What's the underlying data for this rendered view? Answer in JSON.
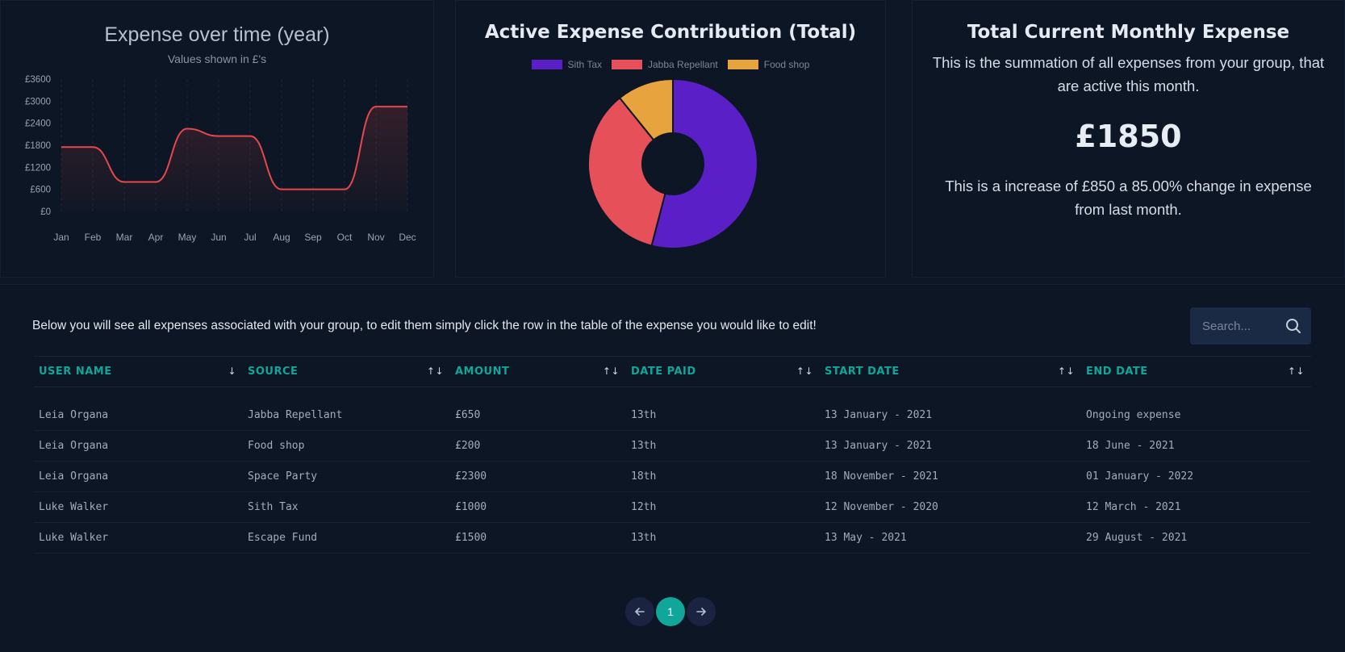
{
  "line_chart": {
    "title": "Expense over time (year)",
    "subtitle": "Values shown in £'s",
    "line_color": "#e5484d",
    "chart_data": {
      "type": "area",
      "categories": [
        "Jan",
        "Feb",
        "Mar",
        "Apr",
        "May",
        "Jun",
        "Jul",
        "Aug",
        "Sep",
        "Oct",
        "Nov",
        "Dec"
      ],
      "values": [
        1750,
        1750,
        800,
        800,
        2250,
        2050,
        2050,
        600,
        600,
        600,
        2850,
        2850
      ],
      "yticks": [
        "£0",
        "£600",
        "£1200",
        "£1800",
        "£2400",
        "£3000",
        "£3600"
      ],
      "ylim": [
        0,
        3600
      ]
    }
  },
  "pie_chart": {
    "title": "Active Expense Contribution (Total)",
    "chart_data": {
      "type": "pie",
      "labels": [
        "Sith Tax",
        "Jabba Repellant",
        "Food shop"
      ],
      "values": [
        1000,
        650,
        200
      ],
      "colors": [
        "#5b1fc7",
        "#e65159",
        "#e6a33e"
      ]
    }
  },
  "total": {
    "title": "Total Current Monthly Expense",
    "description": "This is the summation of all expenses from your group, that are active this month.",
    "amount": "£1850",
    "change": "This is a increase of £850 a 85.00% change in expense from last month."
  },
  "table": {
    "intro": "Below you will see all expenses associated with your group, to edit them simply click the row in the table of the expense you would like to edit!",
    "search_placeholder": "Search...",
    "columns": [
      "USER NAME",
      "SOURCE",
      "AMOUNT",
      "DATE PAID",
      "START DATE",
      "END DATE"
    ],
    "sort_icons": [
      "↓",
      "↑↓",
      "↑↓",
      "↑↓",
      "↑↓",
      "↑↓"
    ],
    "rows": [
      [
        "Leia Organa",
        "Jabba Repellant",
        "£650",
        "13th",
        "13 January - 2021",
        "Ongoing expense"
      ],
      [
        "Leia Organa",
        "Food shop",
        "£200",
        "13th",
        "13 January - 2021",
        "18 June - 2021"
      ],
      [
        "Leia Organa",
        "Space Party",
        "£2300",
        "18th",
        "18 November - 2021",
        "01 January - 2022"
      ],
      [
        "Luke Walker",
        "Sith Tax",
        "£1000",
        "12th",
        "12 November - 2020",
        "12 March - 2021"
      ],
      [
        "Luke Walker",
        "Escape Fund",
        "£1500",
        "13th",
        "13 May - 2021",
        "29 August - 2021"
      ]
    ]
  },
  "pagination": {
    "current": "1",
    "prev_icon": "arrow-left-icon",
    "next_icon": "arrow-right-icon"
  }
}
